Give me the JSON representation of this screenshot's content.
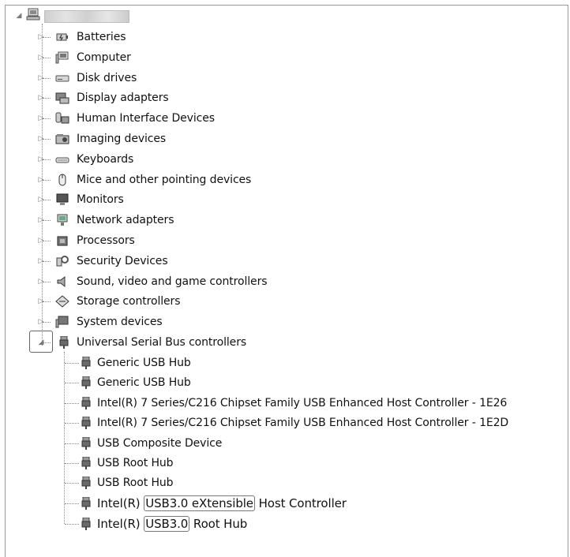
{
  "root": {
    "label_obscured": true
  },
  "categories": [
    {
      "label": "Batteries",
      "icon": "battery-icon"
    },
    {
      "label": "Computer",
      "icon": "computer-icon"
    },
    {
      "label": "Disk drives",
      "icon": "disk-drive-icon"
    },
    {
      "label": "Display adapters",
      "icon": "display-adapter-icon"
    },
    {
      "label": "Human Interface Devices",
      "icon": "hid-icon"
    },
    {
      "label": "Imaging devices",
      "icon": "camera-icon"
    },
    {
      "label": "Keyboards",
      "icon": "keyboard-icon"
    },
    {
      "label": "Mice and other pointing devices",
      "icon": "mouse-icon"
    },
    {
      "label": "Monitors",
      "icon": "monitor-icon"
    },
    {
      "label": "Network adapters",
      "icon": "network-adapter-icon"
    },
    {
      "label": "Processors",
      "icon": "processor-icon"
    },
    {
      "label": "Security Devices",
      "icon": "security-device-icon"
    },
    {
      "label": "Sound, video and game controllers",
      "icon": "speaker-icon"
    },
    {
      "label": "Storage controllers",
      "icon": "storage-controller-icon"
    },
    {
      "label": "System devices",
      "icon": "system-device-icon"
    }
  ],
  "usb": {
    "label": "Universal Serial Bus controllers",
    "children": [
      {
        "label": "Generic USB Hub"
      },
      {
        "label": "Generic USB Hub"
      },
      {
        "label": "Intel(R) 7 Series/C216 Chipset Family USB Enhanced Host Controller - 1E26"
      },
      {
        "label": "Intel(R) 7 Series/C216 Chipset Family USB Enhanced Host Controller - 1E2D"
      },
      {
        "label": "USB Composite Device"
      },
      {
        "label": "USB Root Hub"
      },
      {
        "label": "USB Root Hub"
      }
    ],
    "xhci": {
      "prefix": "Intel(R) ",
      "highlight": "USB3.0 eXtensible",
      "suffix": " Host Controller"
    },
    "xhci_hub": {
      "prefix": "Intel(R) ",
      "highlight": "USB3.0",
      "suffix": " Root Hub"
    }
  },
  "glyphs": {
    "collapsed": "▷",
    "expanded": "◢"
  }
}
